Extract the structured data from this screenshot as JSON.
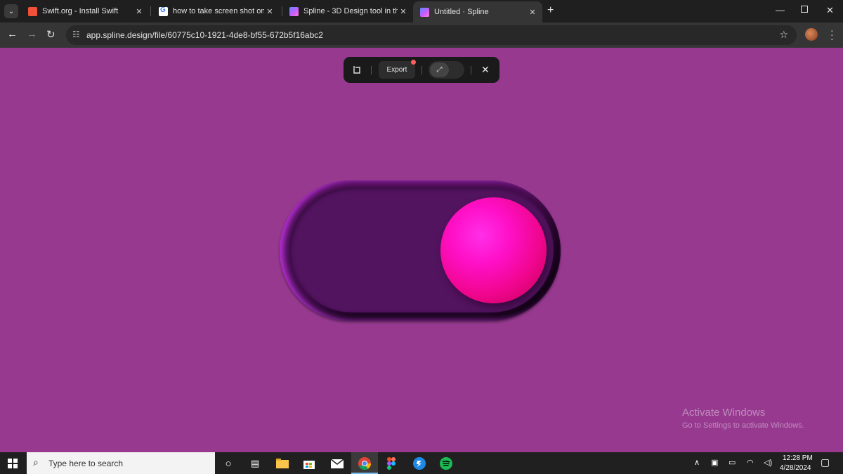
{
  "browser": {
    "tabs": [
      {
        "title": "Swift.org - Install Swift",
        "favicon": "swift-icon",
        "active": false
      },
      {
        "title": "how to take screen shot on wind",
        "favicon": "google-icon",
        "active": false
      },
      {
        "title": "Spline - 3D Design tool in the b",
        "favicon": "spline-icon",
        "active": false
      },
      {
        "title": "Untitled · Spline",
        "favicon": "spline-icon",
        "active": true
      }
    ],
    "url": "app.spline.design/file/60775c10-1921-4de8-bf55-672b5f16abc2"
  },
  "viewer": {
    "export_label": "Export",
    "background_color": "#96398f",
    "toggle": {
      "state": "on",
      "track_color": "#52135f",
      "knob_color": "#ff10c8"
    }
  },
  "watermark": {
    "title": "Activate Windows",
    "subtitle": "Go to Settings to activate Windows."
  },
  "taskbar": {
    "search_placeholder": "Type here to search",
    "apps": [
      "cortana-icon",
      "task-view-icon",
      "file-explorer-icon",
      "store-icon",
      "mail-icon",
      "chrome-icon",
      "figma-icon",
      "app-icon",
      "spotify-icon"
    ],
    "time": "12:28 PM",
    "date": "4/28/2024"
  }
}
